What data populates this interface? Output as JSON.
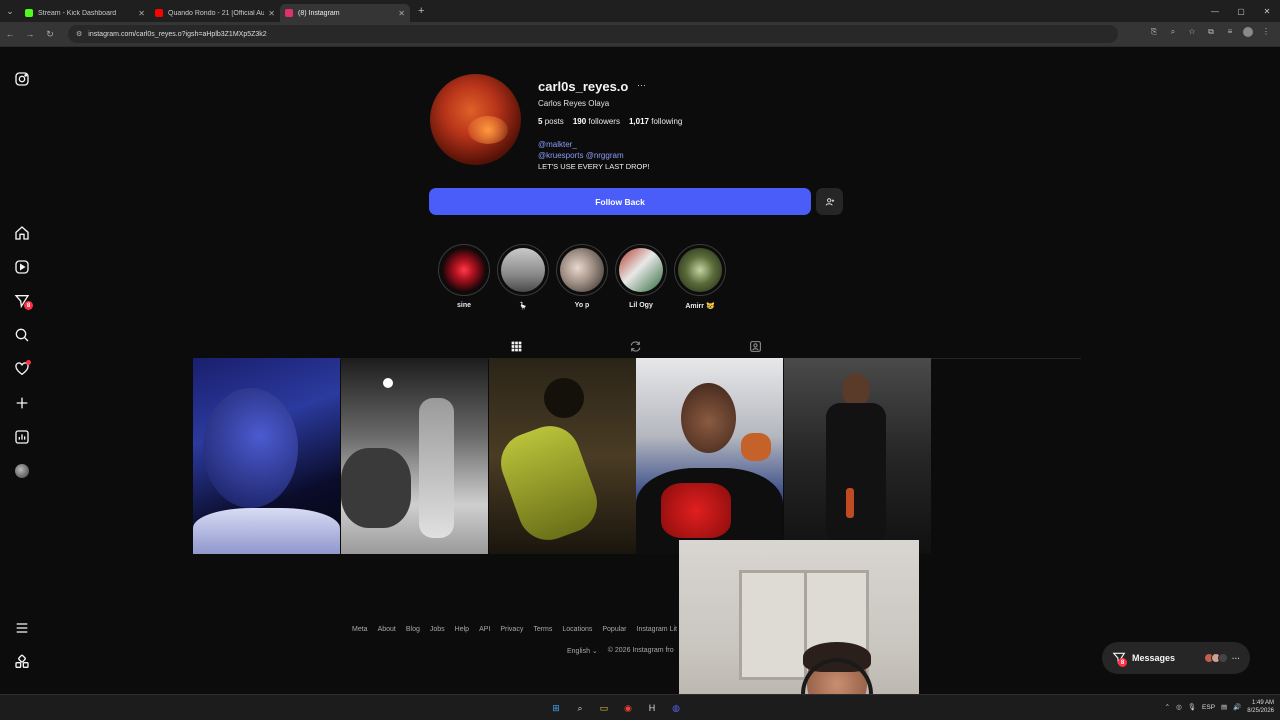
{
  "browser": {
    "tabs": [
      {
        "title": "Stream - Kick Dashboard",
        "favicon_color": "#53fc18",
        "active": false
      },
      {
        "title": "Quando Rondo - 21 [Official Au",
        "favicon_color": "#ff0000",
        "active": false
      },
      {
        "title": "(8) Instagram",
        "favicon_color": "#e1306c",
        "active": true
      }
    ],
    "url": "instagram.com/carl0s_reyes.o?igsh=aHplb3Z1MXp5Z3k2"
  },
  "sidebar": {
    "items": [
      "instagram-logo",
      "home",
      "reels",
      "messages",
      "search",
      "notifications",
      "create",
      "dashboard",
      "profile",
      "more",
      "also-from-meta"
    ],
    "messages_badge": "8"
  },
  "profile": {
    "username": "carl0s_reyes.o",
    "full_name": "Carlos Reyes Olaya",
    "posts_count": "5",
    "posts_label": "posts",
    "followers_count": "190",
    "followers_label": "followers",
    "following_count": "1,017",
    "following_label": "following",
    "bio_mention_1": "@malkter_",
    "bio_mention_2": "@kruesports @nrggram",
    "bio_text": "LET'S USE EVERY LAST DROP!",
    "follow_back_label": "Follow Back"
  },
  "highlights": [
    {
      "label": "sine",
      "color": "#b0121f"
    },
    {
      "label": "🪿",
      "color": "#8a8a8a"
    },
    {
      "label": "Yo p",
      "color": "#9c8c82"
    },
    {
      "label": "Lil Ogy",
      "color": "#7a3a2e"
    },
    {
      "label": "Amirr 😿",
      "color": "#5a6b3a"
    }
  ],
  "profile_tabs": [
    "posts",
    "reposts",
    "tagged"
  ],
  "posts": [
    {
      "alt": "portrait blue light"
    },
    {
      "alt": "black and white garden"
    },
    {
      "alt": "person lying on floor"
    },
    {
      "alt": "portrait with sunglasses"
    },
    {
      "alt": "person in black shirt at night"
    }
  ],
  "footer": {
    "links": [
      "Meta",
      "About",
      "Blog",
      "Jobs",
      "Help",
      "API",
      "Privacy",
      "Terms",
      "Locations",
      "Popular",
      "Instagram Lit"
    ],
    "language": "English",
    "copyright": "© 2026 Instagram fro"
  },
  "messages": {
    "label": "Messages",
    "badge": "8"
  },
  "taskbar": {
    "lang": "ESP",
    "time": "1:49 AM",
    "date": "8/25/2026"
  }
}
